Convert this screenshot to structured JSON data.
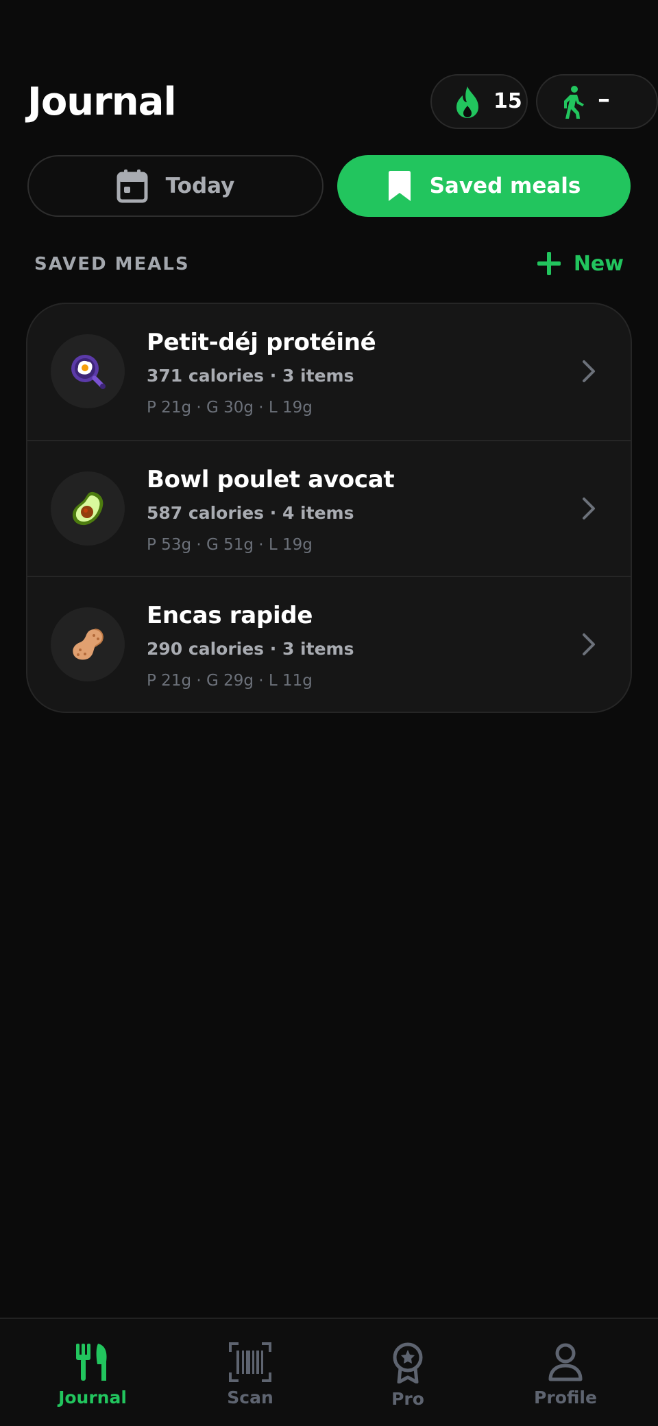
{
  "header": {
    "title": "Journal",
    "streak_count": "15",
    "steps_value": "–"
  },
  "tabs": [
    {
      "label": "Today",
      "icon": "calendar-icon",
      "active": false
    },
    {
      "label": "Saved meals",
      "icon": "bookmark-icon",
      "active": true
    }
  ],
  "section": {
    "title": "SAVED MEALS",
    "new_label": "New"
  },
  "meals": [
    {
      "name": "Petit-déj protéiné",
      "summary": "371 calories · 3 items",
      "macros": "P 21g · G 30g · L 19g",
      "icon": "fried-egg-pan-icon"
    },
    {
      "name": "Bowl poulet avocat",
      "summary": "587 calories · 4 items",
      "macros": "P 53g · G 51g · L 19g",
      "icon": "avocado-icon"
    },
    {
      "name": "Encas rapide",
      "summary": "290 calories · 3 items",
      "macros": "P 21g · G 29g · L 11g",
      "icon": "peanut-icon"
    }
  ],
  "nav": [
    {
      "label": "Journal",
      "icon": "fork-knife-icon",
      "active": true
    },
    {
      "label": "Scan",
      "icon": "barcode-icon",
      "active": false
    },
    {
      "label": "Pro",
      "icon": "award-icon",
      "active": false
    },
    {
      "label": "Profile",
      "icon": "user-icon",
      "active": false
    }
  ],
  "colors": {
    "accent": "#22c55e",
    "background": "#0b0b0b",
    "card": "#161616",
    "muted_text": "#a9acb2",
    "dim_text": "#6c717a"
  }
}
